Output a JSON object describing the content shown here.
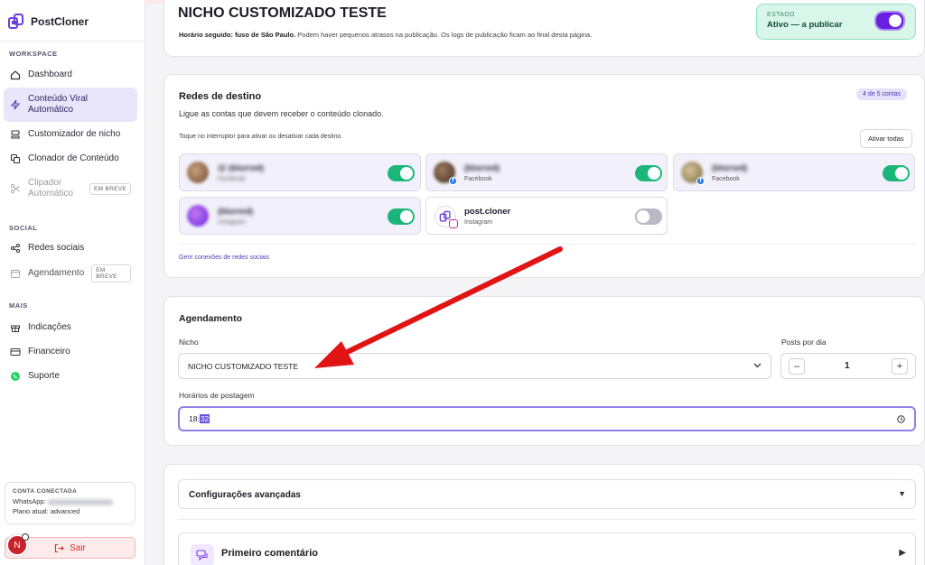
{
  "app": {
    "name": "PostCloner"
  },
  "sidebar": {
    "workspace_label": "WORKSPACE",
    "social_label": "SOCIAL",
    "more_label": "MAIS",
    "items": [
      {
        "label": "Dashboard",
        "icon": "home-icon"
      },
      {
        "label": "Conteúdo Viral Automático",
        "icon": "lightning-icon",
        "active": true
      },
      {
        "label": "Customizador de nicho",
        "icon": "layers-icon"
      },
      {
        "label": "Clonador de Conteúdo",
        "icon": "copy-icon"
      },
      {
        "label": "Clipador Automático",
        "icon": "scissors-icon",
        "badge": "EM BREVE"
      },
      {
        "label": "Redes sociais",
        "icon": "share-icon"
      },
      {
        "label": "Agendamento",
        "icon": "calendar-icon",
        "badge": "EM BREVE"
      },
      {
        "label": "Indicações",
        "icon": "gift-icon"
      },
      {
        "label": "Financeiro",
        "icon": "card-icon"
      },
      {
        "label": "Suporte",
        "icon": "whatsapp-icon"
      }
    ],
    "account": {
      "title": "CONTA CONECTADA",
      "whatsapp_label": "WhatsApp:",
      "plan": "Plano atual: advanced"
    },
    "logout": "Sair",
    "avatar_letter": "N"
  },
  "header": {
    "title": "NICHO CUSTOMIZADO TESTE",
    "subtitle_bold": "Horário seguido: fuso de São Paulo.",
    "subtitle_rest": " Podem haver pequenos atrasos na publicação. Os logs de publicação ficam ao final desta página.",
    "status_label": "ESTADO",
    "status_value": "Ativo — a publicar"
  },
  "networks": {
    "title": "Redes de destino",
    "count": "4 de 5 contas",
    "description": "Ligue as contas que devem receber o conteúdo clonado.",
    "hint": "Toque no interruptor para ativar ou desativar cada destino.",
    "activate_all": "Ativar todas",
    "accounts": [
      {
        "name": "@ (blurred)",
        "platform": "",
        "on": true
      },
      {
        "name": "(blurred)",
        "platform": "Facebook",
        "on": true
      },
      {
        "name": "(blurred)",
        "platform": "Facebook",
        "on": true
      },
      {
        "name": "(blurred)",
        "platform": "",
        "on": true
      },
      {
        "name": "post.cloner",
        "platform": "Instagram",
        "on": false
      }
    ],
    "manage_link": "Gerir conexões de redes sociais"
  },
  "schedule": {
    "title": "Agendamento",
    "niche_label": "Nicho",
    "niche_value": "NICHO CUSTOMIZADO TESTE",
    "posts_label": "Posts por dia",
    "posts_value": "1",
    "minus": "–",
    "plus": "+",
    "times_label": "Horários de postagem",
    "time_hour": "18:",
    "time_min": "32"
  },
  "advanced": {
    "title": "Configurações avançadas"
  },
  "first_comment": {
    "title": "Primeiro comentário"
  },
  "colors": {
    "accent": "#6a1ee0",
    "green": "#1bb77a",
    "arrow": "#e11414"
  }
}
